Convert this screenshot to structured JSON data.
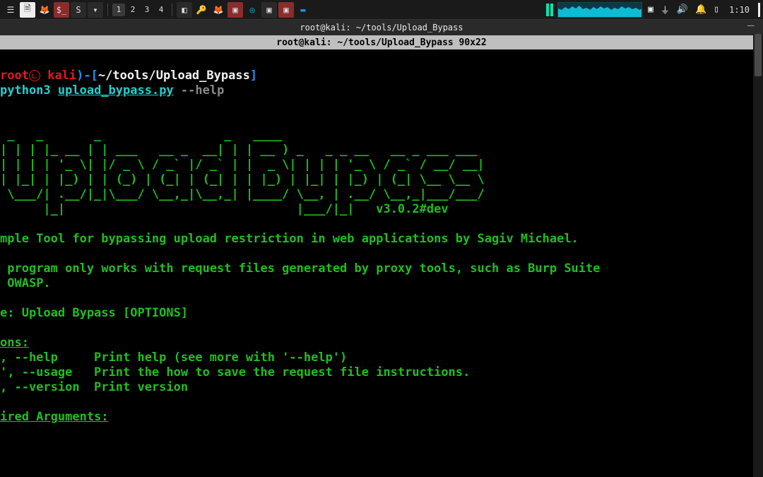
{
  "taskbar": {
    "workspaces": [
      "1",
      "2",
      "3",
      "4"
    ],
    "active_workspace": 0,
    "clock": "1:10"
  },
  "window": {
    "title": "root@kali: ~/tools/Upload_Bypass",
    "dimensions": "root@kali: ~/tools/Upload_Bypass 90x22"
  },
  "prompt": {
    "user": "root",
    "at": "㉿",
    "host": "kali",
    "cwd": "~/tools/Upload_Bypass",
    "command_interp": "python3",
    "command_script": "upload_bypass.py",
    "command_arg": "--help"
  },
  "ascii_art": [
    " _   _       _                 _   ____",
    "| | | |_ __ | | ___   __ _  __| | | __ ) _   _ _ __   __ _ ___ ___",
    "| | | | '_ \\| |/ _ \\ / _` |/ _` | |  _ \\| | | | '_ \\ / _` / __/ __|",
    "| |_| | |_) | | (_) | (_| | (_| | | |_) | |_| | |_) | (_| \\__ \\__ \\",
    " \\___/| .__/|_|\\___/ \\__,_|\\__,_| |____/ \\__, | .__/ \\__,_|___/___/",
    "      |_|                                |___/|_|   v3.0.2#dev"
  ],
  "description": "mple Tool for bypassing upload restriction in web applications by Sagiv Michael.",
  "note": " program only works with request files generated by proxy tools, such as Burp Suite\n OWASP.",
  "usage_line": "e: Upload Bypass [OPTIONS]",
  "options_header": "ons:",
  "options": [
    ", --help     Print help (see more with '--help')",
    "', --usage   Print the how to save the request file instructions.",
    ", --version  Print version"
  ],
  "required_header": "ired Arguments:"
}
